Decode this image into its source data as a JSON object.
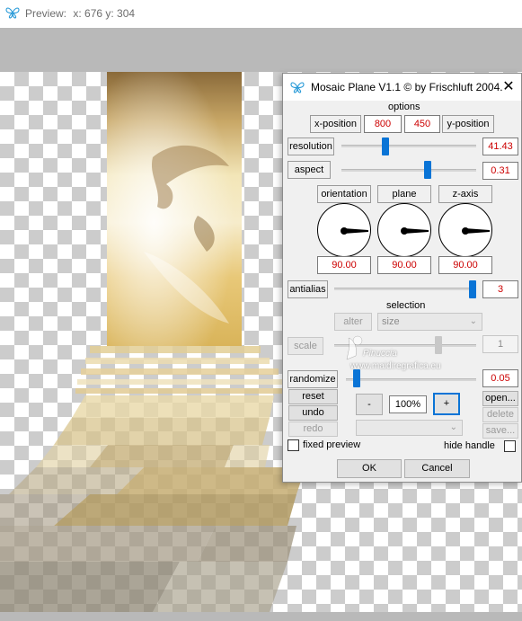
{
  "preview": {
    "title": "Preview:",
    "coords": "x: 676 y: 304"
  },
  "dialog": {
    "title": "Mosaic Plane V1.1 © by Frischluft 2004.",
    "close_glyph": "✕",
    "options_label": "options",
    "x_position_label": "x-position",
    "x_value": "800",
    "y_value": "450",
    "y_position_label": "y-position",
    "resolution_label": "resolution",
    "resolution_value": "41.43",
    "resolution_level": 0.32,
    "aspect_label": "aspect",
    "aspect_value": "0.31",
    "aspect_level": 0.65,
    "orientation_label": "orientation",
    "plane_label": "plane",
    "zaxis_label": "z-axis",
    "orientation_value": "90.00",
    "plane_value": "90.00",
    "zaxis_value": "90.00",
    "antialias_label": "antialias",
    "antialias_value": "3",
    "antialias_level": 1.0,
    "selection_label": "selection",
    "alter_label": "alter",
    "size_option": "size",
    "scale_label": "scale",
    "scale_value": "1",
    "randomize_label": "randomize",
    "randomize_value": "0.05",
    "reset_label": "reset",
    "undo_label": "undo",
    "redo_label": "redo",
    "minus_label": "-",
    "zoom_value": "100%",
    "plus_label": "+",
    "open_label": "open...",
    "delete_label": "delete",
    "save_label": "save...",
    "fixed_preview_label": "fixed preview",
    "hide_handle_label": "hide handle",
    "ok_label": "OK",
    "cancel_label": "Cancel"
  },
  "watermark": {
    "line1": "Pinuccia",
    "line2": "www.maidiregrafica.eu"
  },
  "colors": {
    "accent": "#0a74d6",
    "value_text": "#cc0000"
  }
}
